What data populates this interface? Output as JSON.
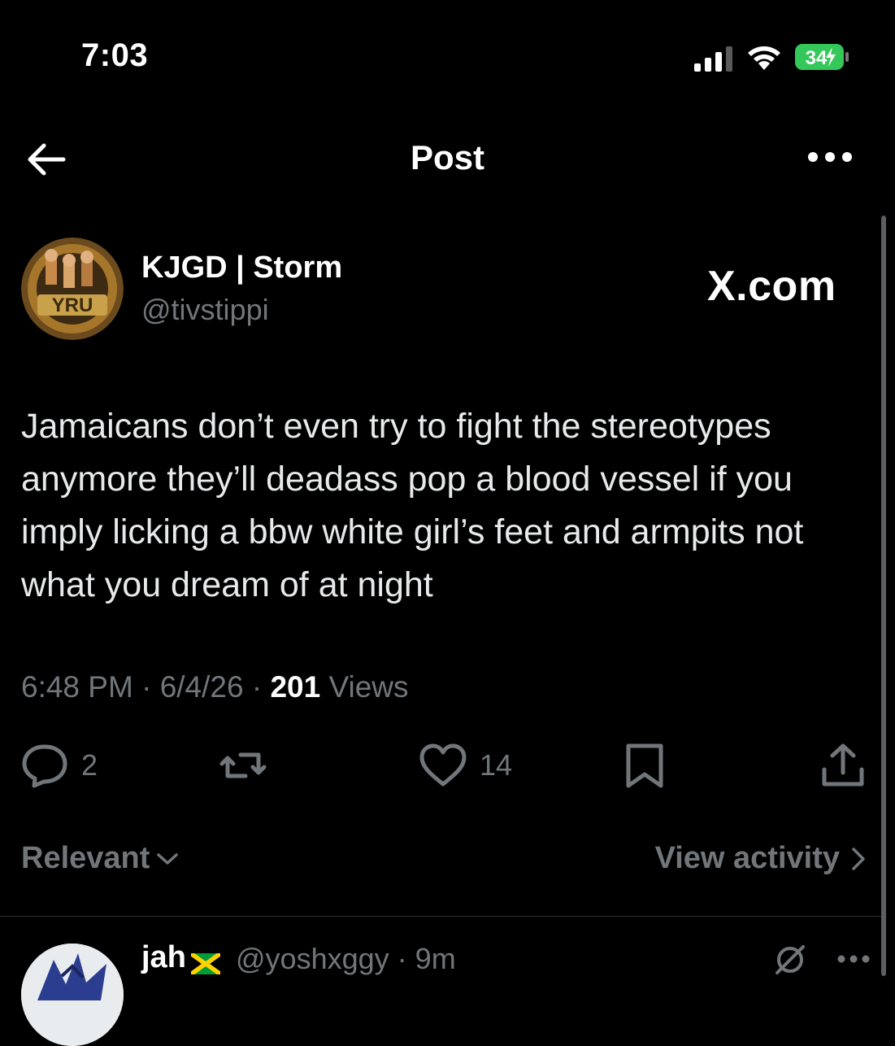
{
  "status_bar": {
    "time": "7:03",
    "battery": "34"
  },
  "nav": {
    "title": "Post"
  },
  "author": {
    "name": "KJGD | Storm",
    "handle": "@tivstippi",
    "avatar_text": "YRU"
  },
  "watermark": "X.com",
  "post": {
    "text": "Jamaicans don’t even try to fight the stereotypes anymore they’ll deadass pop a blood vessel if you imply licking a bbw white girl’s feet and armpits not what you dream of at night",
    "time": "6:48 PM",
    "date": "6/4/26",
    "views_count": "201",
    "views_label": "Views",
    "sep": "·"
  },
  "actions": {
    "replies": "2",
    "likes": "14"
  },
  "filters": {
    "sort_label": "Relevant",
    "view_activity_label": "View activity"
  },
  "reply": {
    "name": "jah",
    "flag": "🇯🇲",
    "handle": "@yoshxggy",
    "sep": "·",
    "age": "9m"
  },
  "colors": {
    "background": "#000000",
    "text": "#e7e9ea",
    "muted": "#71767b",
    "battery": "#34c759"
  }
}
